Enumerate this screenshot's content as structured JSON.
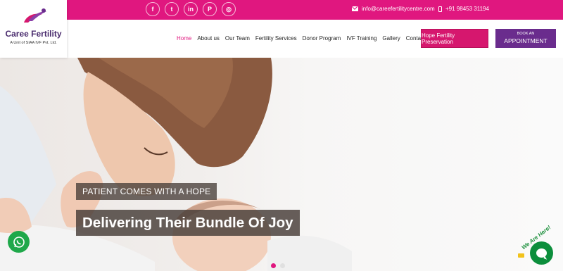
{
  "topbar": {
    "socials": [
      {
        "icon": "facebook-icon",
        "glyph": "f"
      },
      {
        "icon": "twitter-icon",
        "glyph": "t"
      },
      {
        "icon": "linkedin-icon",
        "glyph": "in"
      },
      {
        "icon": "pinterest-icon",
        "glyph": "P"
      },
      {
        "icon": "instagram-icon",
        "glyph": "◎"
      }
    ],
    "email": "info@careefertilitycentre.com",
    "phone": "+91 98453 31194"
  },
  "logo": {
    "name": "Caree Fertility",
    "subtitle": "A Unit of SIAA IVF Pvt. Ltd."
  },
  "nav": {
    "items": [
      "Home",
      "About us",
      "Our Team",
      "Fertility Services",
      "Donor Program",
      "IVF Training",
      "Gallery",
      "Contact Us"
    ],
    "active_index": 0
  },
  "buttons": {
    "hope": "Hope Fertility Preservation",
    "book_line1": "BOOK AN",
    "book_line2": "APPOINTMENT"
  },
  "hero": {
    "tagline": "PATIENT COMES WITH A HOPE",
    "headline": "Delivering Their Bundle Of Joy",
    "slides_total": 2,
    "active_slide": 0
  },
  "widgets": {
    "whatsapp_icon": "whatsapp-icon",
    "chat_label": "We Are Here!"
  },
  "colors": {
    "primary_pink": "#e0177f",
    "purple": "#6a2c8d",
    "whatsapp_green": "#1fa84a"
  }
}
